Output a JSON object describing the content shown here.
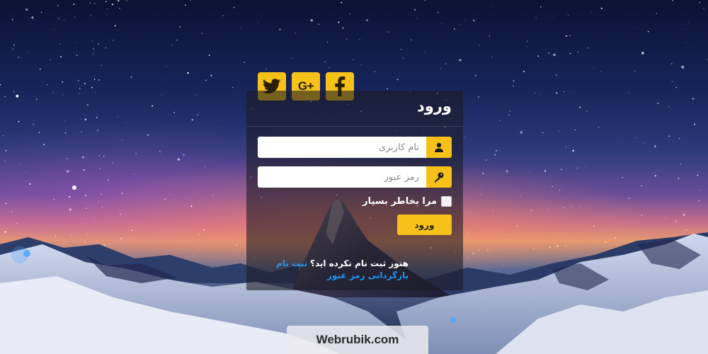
{
  "login": {
    "title": "ورود",
    "username_placeholder": "نام کاربری",
    "password_placeholder": "رمز عبور",
    "remember_label": "مرا بخاطر بسپار",
    "submit_label": "ورود",
    "no_account_text": "هنوز ثبت نام نکرده اید؟",
    "register_link": "ثبت نام",
    "recover_link": "بازگردانی رمز عبور"
  },
  "social": {
    "buttons": [
      "twitter-icon",
      "google-plus-icon",
      "facebook-icon"
    ],
    "google_plus_label": "G+"
  },
  "watermark": "Webrubik.com",
  "colors": {
    "accent": "#f6c21a",
    "link": "#2196f3",
    "panel": "rgba(25,25,35,0.58)"
  }
}
